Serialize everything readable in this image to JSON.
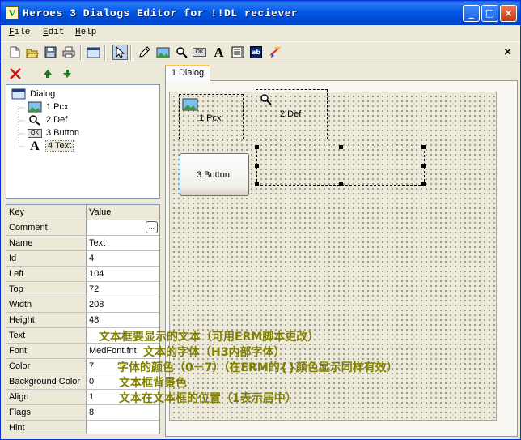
{
  "window": {
    "title": "Heroes 3 Dialogs Editor for !!DL reciever",
    "icon_letter": "V",
    "controls": {
      "minimize": "_",
      "maximize": "□",
      "close": "×"
    }
  },
  "menu": {
    "file": {
      "mnemonic": "F",
      "rest": "ile"
    },
    "edit": {
      "mnemonic": "E",
      "rest": "dit"
    },
    "help": {
      "mnemonic": "H",
      "rest": "elp"
    }
  },
  "toolbar": {
    "icons": [
      "new-file-icon",
      "open-folder-icon",
      "save-disk-icon",
      "print-icon",
      "dialog-window-icon",
      "pointer-arrow-icon",
      "pencil-icon",
      "picture-pcx-icon",
      "magnifier-def-icon",
      "ok-button-icon",
      "text-a-icon",
      "list-icon",
      "edit-field-icon",
      "paint-brush-icon"
    ],
    "text_tool_glyph": "A",
    "ok_glyph": "OK",
    "edit_glyph": "ab",
    "close_glyph": "×"
  },
  "tree": {
    "root": "Dialog",
    "items": [
      {
        "label": "1  Pcx",
        "icon": "picture-icon"
      },
      {
        "label": "2  Def",
        "icon": "magnifier-icon"
      },
      {
        "label": "3  Button",
        "icon": "ok-button-icon",
        "glyph": "OK"
      },
      {
        "label": "4  Text",
        "icon": "text-icon",
        "glyph": "A"
      }
    ]
  },
  "grid": {
    "header": {
      "key": "Key",
      "value": "Value"
    },
    "rows": [
      {
        "key": "Comment",
        "value": ""
      },
      {
        "key": "Name",
        "value": "Text"
      },
      {
        "key": "Id",
        "value": "4"
      },
      {
        "key": "Left",
        "value": "104"
      },
      {
        "key": "Top",
        "value": "72"
      },
      {
        "key": "Width",
        "value": "208"
      },
      {
        "key": "Height",
        "value": "48"
      },
      {
        "key": "Text",
        "value": ""
      },
      {
        "key": "Font",
        "value": "MedFont.fnt"
      },
      {
        "key": "Color",
        "value": "7"
      },
      {
        "key": "Background Color",
        "value": "0"
      },
      {
        "key": "Align",
        "value": "1"
      },
      {
        "key": "Flags",
        "value": "8"
      },
      {
        "key": "Hint",
        "value": ""
      }
    ],
    "ellipsis": "..."
  },
  "tab": {
    "label": "1  Dialog"
  },
  "canvas": {
    "widgets": {
      "pcx": "1  Pcx",
      "def": "2  Def",
      "button": "3  Button"
    }
  },
  "annotations": {
    "text": "文本框要显示的文本（可用ERM脚本更改）",
    "font": "文本的字体（H3内部字体）",
    "color": "字体的颜色（0－7）（在ERM的{}颜色显示同样有效）",
    "background": "文本框背景色",
    "align": "文本在文本框的位置（1表示居中）"
  }
}
